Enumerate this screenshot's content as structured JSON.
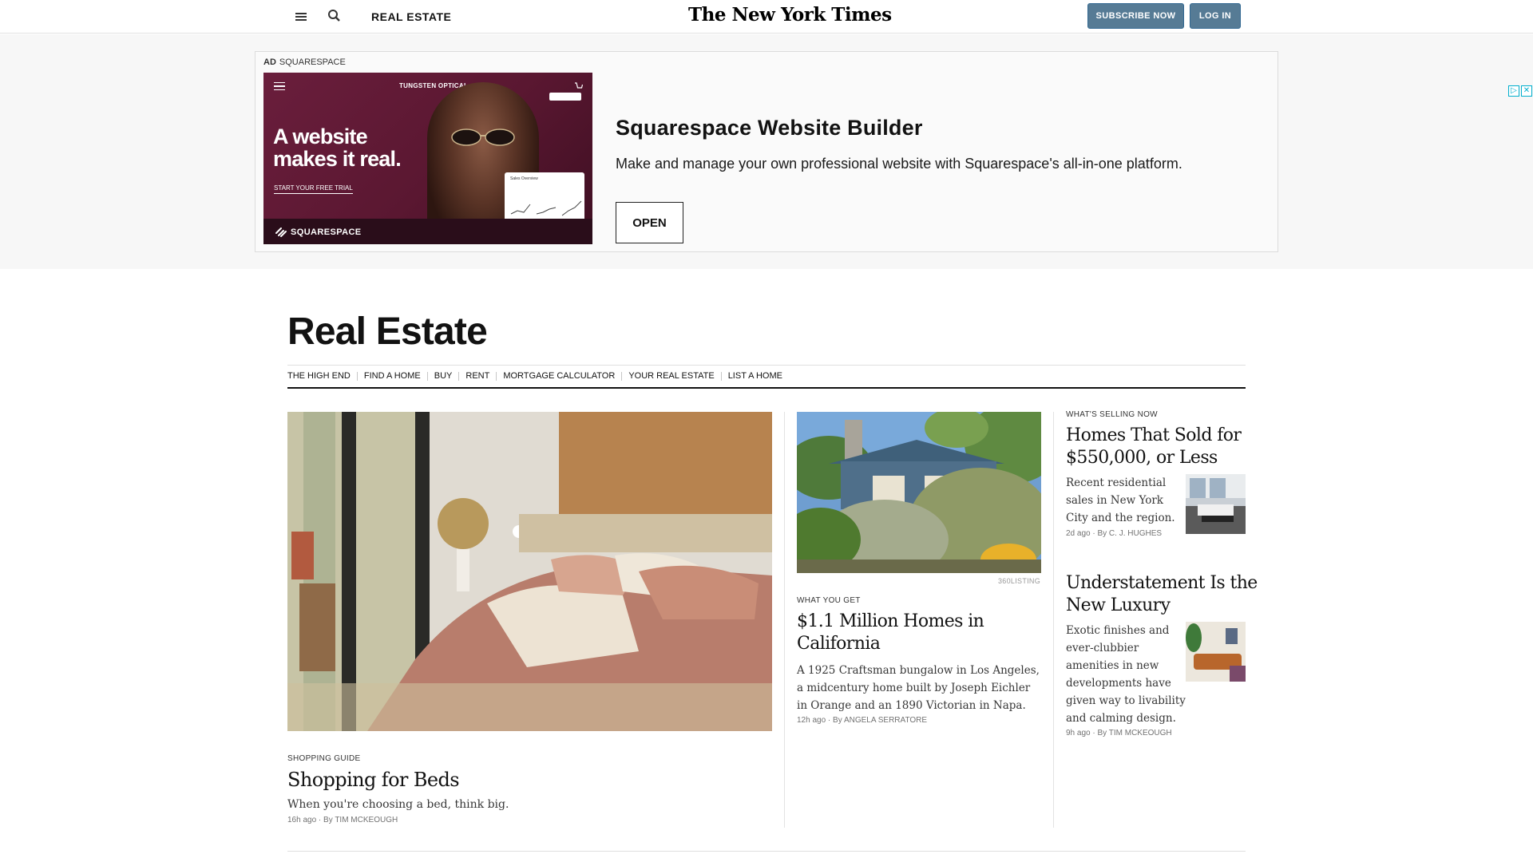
{
  "topbar": {
    "section": "REAL ESTATE",
    "logo": "The New York Times",
    "subscribe": "SUBSCRIBE NOW",
    "login": "LOG IN"
  },
  "ad": {
    "label": "AD",
    "advertiser": "SQUARESPACE",
    "image": {
      "brand": "TUNGSTEN OPTICAL",
      "headline": "A website makes it real.",
      "cta": "START YOUR FREE TRIAL",
      "card_title": "Sales Overview",
      "footer": "SQUARESPACE"
    },
    "title": "Squarespace Website Builder",
    "description": "Make and manage your own professional website with Squarespace's all-in-one platform.",
    "button": "OPEN"
  },
  "page": {
    "title": "Real Estate",
    "subnav": [
      "THE HIGH END",
      "FIND A HOME",
      "BUY",
      "RENT",
      "MORTGAGE CALCULATOR",
      "YOUR REAL ESTATE",
      "LIST A HOME"
    ]
  },
  "stories": {
    "lead": {
      "kicker": "SHOPPING GUIDE",
      "headline": "Shopping for Beds",
      "summary": "When you're choosing a bed, think big.",
      "time": "16h ago",
      "byline": "By TIM MCKEOUGH"
    },
    "second": {
      "credit": "360LISTING",
      "kicker": "WHAT YOU GET",
      "headline": "$1.1 Million Homes in California",
      "summary": "A 1925 Craftsman bungalow in Los Angeles, a midcentury home built by Joseph Eichler in Orange and an 1890 Victorian in Napa.",
      "time": "12h ago",
      "byline": "By ANGELA SERRATORE"
    },
    "third": {
      "kicker": "WHAT'S SELLING NOW",
      "headline": "Homes That Sold for $550,000, or Less",
      "summary": "Recent residential sales in New York City and the region.",
      "time": "2d ago",
      "byline": "By C. J. HUGHES"
    },
    "fourth": {
      "headline": "Understatement Is the New Luxury",
      "summary": "Exotic finishes and ever-clubbier amenities in new developments have given way to livability and calming design.",
      "time": "9h ago",
      "byline": "By TIM MCKEOUGH"
    }
  }
}
